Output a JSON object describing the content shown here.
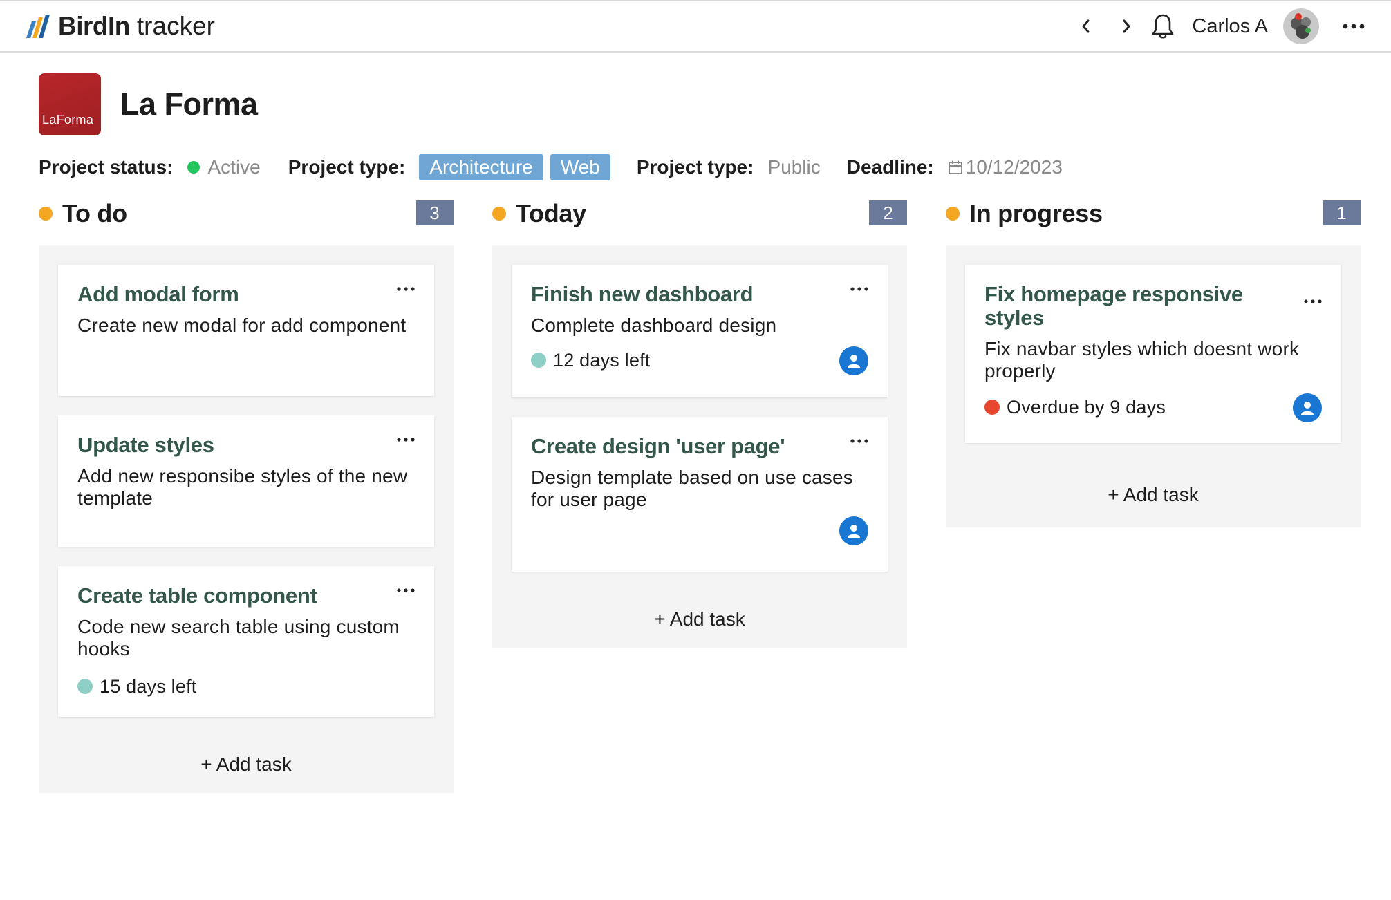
{
  "app": {
    "brand_name": "BirdIn",
    "brand_suffix": "tracker"
  },
  "topnav": {
    "user_name": "Carlos A"
  },
  "project": {
    "logo_text": "LaForma",
    "title": "La Forma",
    "status_label": "Project status:",
    "status_value": "Active",
    "type_label": "Project type:",
    "tags": [
      "Architecture",
      "Web"
    ],
    "visibility_label": "Project type:",
    "visibility_value": "Public",
    "deadline_label": "Deadline:",
    "deadline_value": "10/12/2023"
  },
  "columns": [
    {
      "title": "To do",
      "count": "3",
      "cards": [
        {
          "title": "Add modal form",
          "desc": "Create new modal for add component"
        },
        {
          "title": "Update styles",
          "desc": "Add new responsibe styles of the new template"
        },
        {
          "title": "Create table component",
          "desc": "Code new search table using custom hooks",
          "due": "15 days left"
        }
      ],
      "add_label": "+ Add task"
    },
    {
      "title": "Today",
      "count": "2",
      "cards": [
        {
          "title": "Finish new dashboard",
          "desc": "Complete dashboard design",
          "due": "12 days left"
        },
        {
          "title": "Create design 'user page'",
          "desc": "Design template based on use cases for user page"
        }
      ],
      "add_label": "+ Add task"
    },
    {
      "title": "In progress",
      "count": "1",
      "cards": [
        {
          "title": "Fix homepage responsive styles",
          "desc": "Fix navbar styles which doesnt work properly",
          "due": "Overdue by 9 days"
        }
      ],
      "add_label": "+ Add task"
    }
  ],
  "colors": {
    "column_dot": "#f5a623",
    "due_ok": "#8ed0c6",
    "due_overdue": "#e8472f",
    "status_active": "#22c55e",
    "tag": "#6fa6d4",
    "count_badge": "#6b7a9a"
  }
}
